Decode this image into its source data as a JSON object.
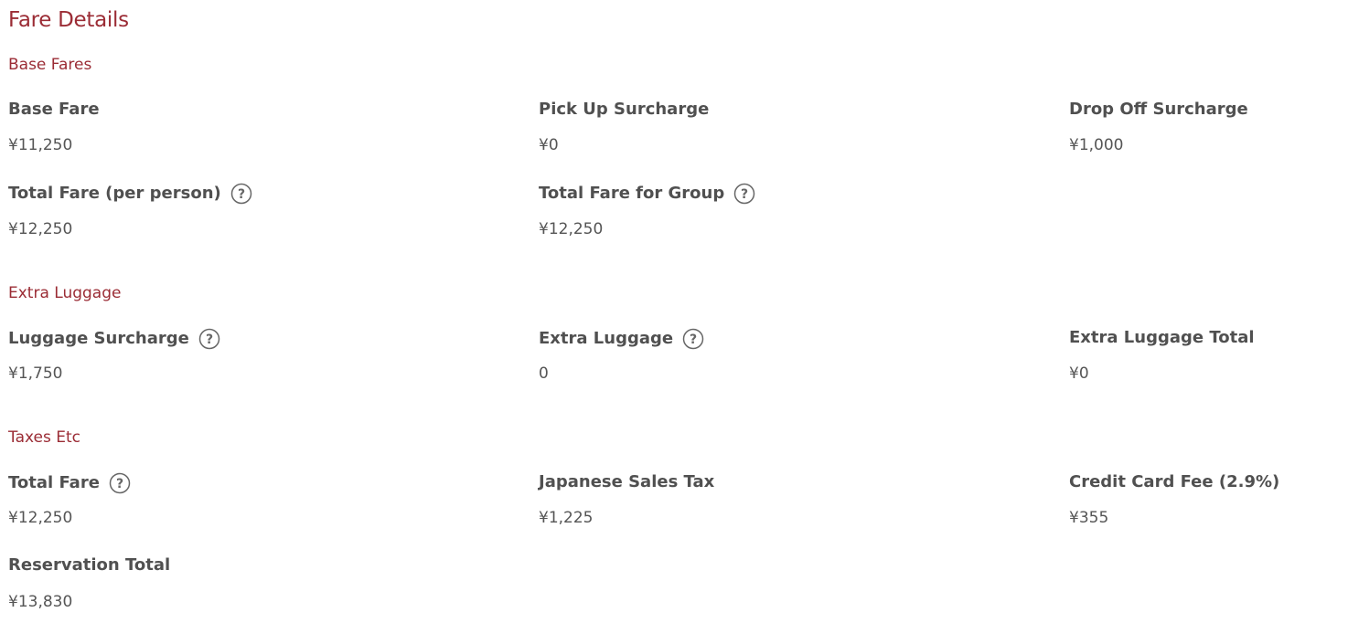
{
  "title": "Fare Details",
  "sections": {
    "base": {
      "title": "Base Fares",
      "base_fare": {
        "label": "Base Fare",
        "value": "¥11,250"
      },
      "pickup": {
        "label": "Pick Up Surcharge",
        "value": "¥0"
      },
      "dropoff": {
        "label": "Drop Off Surcharge",
        "value": "¥1,000"
      },
      "total_per_person": {
        "label": "Total Fare (per person)",
        "value": "¥12,250",
        "icon": "question-circle-icon"
      },
      "total_group": {
        "label": "Total Fare for Group",
        "value": "¥12,250",
        "icon": "question-circle-icon"
      }
    },
    "luggage": {
      "title": "Extra Luggage",
      "surcharge": {
        "label": "Luggage Surcharge",
        "value": "¥1,750",
        "icon": "question-circle-icon"
      },
      "extra": {
        "label": "Extra Luggage",
        "value": "0",
        "icon": "question-circle-icon"
      },
      "total": {
        "label": "Extra Luggage Total",
        "value": "¥0"
      }
    },
    "taxes": {
      "title": "Taxes Etc",
      "total_fare": {
        "label": "Total Fare",
        "value": "¥12,250",
        "icon": "question-circle-icon"
      },
      "sales_tax": {
        "label": "Japanese Sales Tax",
        "value": "¥1,225"
      },
      "cc_fee": {
        "label": "Credit Card Fee (2.9%)",
        "value": "¥355"
      },
      "reservation_total": {
        "label": "Reservation Total",
        "value": "¥13,830"
      }
    }
  },
  "colors": {
    "accent": "#9b2c35",
    "label": "#505050",
    "value": "#555555"
  }
}
